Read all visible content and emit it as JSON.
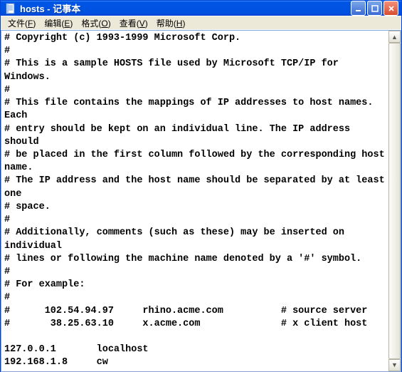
{
  "window": {
    "title": "hosts - 记事本"
  },
  "menubar": {
    "file": {
      "label": "文件",
      "key": "F"
    },
    "edit": {
      "label": "编辑",
      "key": "E"
    },
    "format": {
      "label": "格式",
      "key": "O"
    },
    "view": {
      "label": "查看",
      "key": "V"
    },
    "help": {
      "label": "帮助",
      "key": "H"
    }
  },
  "content": "# Copyright (c) 1993-1999 Microsoft Corp.\n#\n# This is a sample HOSTS file used by Microsoft TCP/IP for Windows.\n#\n# This file contains the mappings of IP addresses to host names. Each\n# entry should be kept on an individual line. The IP address should\n# be placed in the first column followed by the corresponding host name.\n# The IP address and the host name should be separated by at least one\n# space.\n#\n# Additionally, comments (such as these) may be inserted on individual\n# lines or following the machine name denoted by a '#' symbol.\n#\n# For example:\n#\n#      102.54.94.97     rhino.acme.com          # source server\n#       38.25.63.10     x.acme.com              # x client host\n\n127.0.0.1       localhost\n192.168.1.8     cw"
}
